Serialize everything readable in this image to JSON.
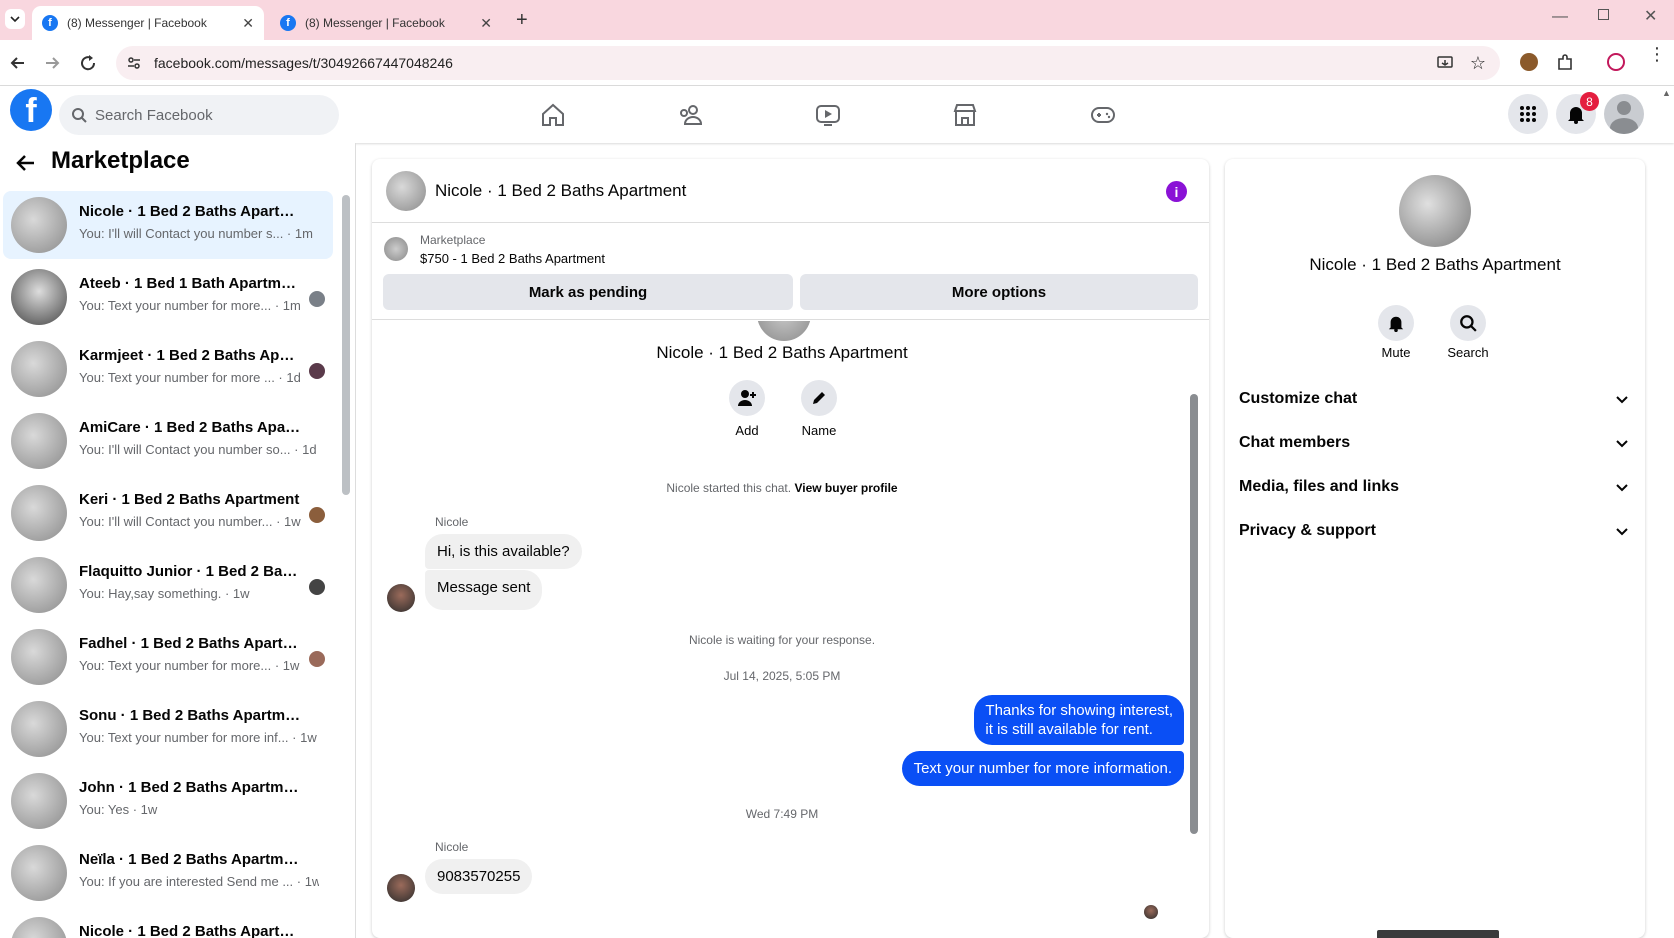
{
  "browser": {
    "tabs": [
      {
        "title": "(8) Messenger | Facebook",
        "active": true
      },
      {
        "title": "(8) Messenger | Facebook",
        "active": false
      }
    ],
    "url": "facebook.com/messages/t/30492667447048246"
  },
  "header": {
    "search_placeholder": "Search Facebook",
    "notification_count": "8",
    "brand_color": "#1877f2"
  },
  "sidebar": {
    "title": "Marketplace",
    "conversations": [
      {
        "name": "Nicole · 1 Bed 2 Baths Apartment",
        "preview": "You: I'll will Contact you number s... · 1m",
        "selected": true
      },
      {
        "name": "Ateeb · 1 Bed 1 Bath Apartment",
        "preview": "You: Text your number for more... · 1m"
      },
      {
        "name": "Karmjeet · 1 Bed 2 Baths Apar...",
        "preview": "You: Text your number for more ... · 1d"
      },
      {
        "name": "AmiCare · 1 Bed 2 Baths Apartm...",
        "preview": "You: I'll will Contact you number so... · 1d"
      },
      {
        "name": "Keri · 1 Bed 2 Baths Apartment",
        "preview": "You: I'll will Contact you number... · 1w"
      },
      {
        "name": "Flaquitto Junior · 1 Bed 2 Bath...",
        "preview": "You: Hay,say something. · 1w"
      },
      {
        "name": "Fadhel · 1 Bed 2 Baths Apartm...",
        "preview": "You: Text your number for more... · 1w"
      },
      {
        "name": "Sonu · 1 Bed 2 Baths Apartment",
        "preview": "You: Text your number for more inf... · 1w"
      },
      {
        "name": "John · 1 Bed 2 Baths Apartment",
        "preview": "You: Yes · 1w"
      },
      {
        "name": "Neïla · 1 Bed 2 Baths Apartment",
        "preview": "You: If you are interested Send me ... · 1w"
      },
      {
        "name": "Nicole · 1 Bed 2 Baths Apartm...",
        "preview": ""
      }
    ]
  },
  "chat": {
    "title": "Nicole · 1 Bed 2 Baths Apartment",
    "listing_source": "Marketplace",
    "listing_price_title": "$750 - 1 Bed 2 Baths Apartment",
    "mark_pending": "Mark as pending",
    "more_options": "More options",
    "profile_name": "Nicole · 1 Bed 2 Baths Apartment",
    "add_label": "Add",
    "name_label": "Name",
    "started_text": "Nicole started this chat.",
    "view_buyer": "View buyer profile",
    "sender1": "Nicole",
    "msg1": "Hi, is this available?",
    "msg2": "Message sent",
    "waiting": "Nicole is waiting for your response.",
    "date1": "Jul 14, 2025, 5:05 PM",
    "out1_line1": "Thanks for showing interest,",
    "out1_line2": "it is still available for rent.",
    "out2": "Text your number for more information.",
    "date2": "Wed 7:49 PM",
    "sender2": "Nicole",
    "msg3": "9083570255",
    "outgoing_color": "#0a4ff5"
  },
  "details": {
    "name": "Nicole · 1 Bed 2 Baths Apartment",
    "mute": "Mute",
    "search": "Search",
    "sections": [
      "Customize chat",
      "Chat members",
      "Media, files and links",
      "Privacy & support"
    ]
  }
}
